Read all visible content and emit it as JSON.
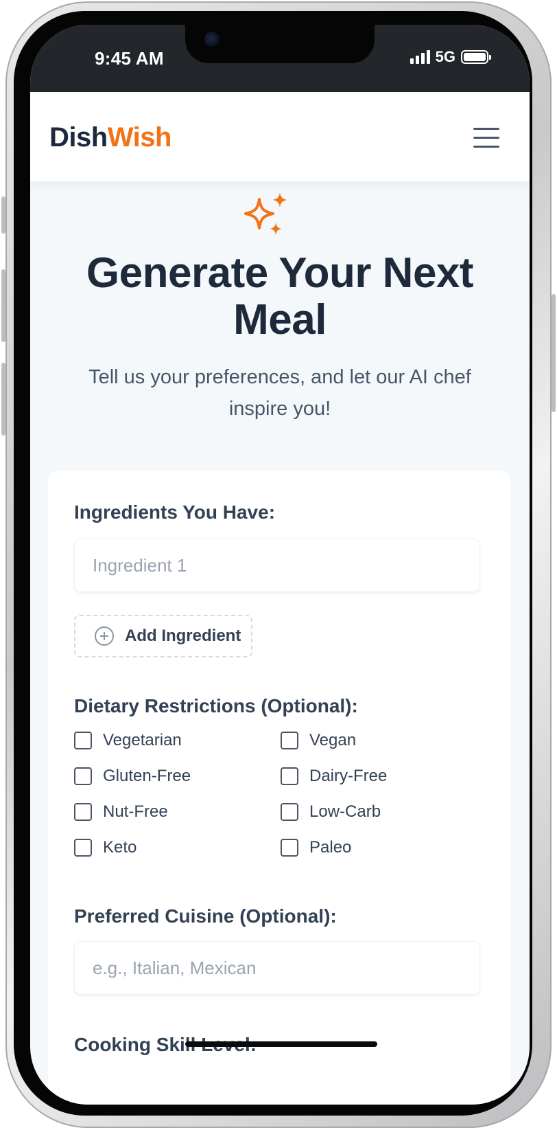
{
  "status_bar": {
    "time": "9:45 AM",
    "network": "5G",
    "battery_level": 1.0
  },
  "header": {
    "brand_part1": "Dish",
    "brand_part2": "Wish",
    "menu_icon": "hamburger-menu-icon",
    "accent_color": "#f47216",
    "brand_dark_color": "#1e293b"
  },
  "hero": {
    "icon": "sparkles-icon",
    "title": "Generate Your Next Meal",
    "subtitle": "Tell us your preferences, and let our AI chef inspire you!"
  },
  "form": {
    "ingredients": {
      "label": "Ingredients You Have:",
      "input_placeholder": "Ingredient 1",
      "add_button_label": "Add Ingredient",
      "add_icon": "plus-circle-icon"
    },
    "dietary": {
      "label": "Dietary Restrictions (Optional):",
      "options": [
        {
          "label": "Vegetarian",
          "checked": false
        },
        {
          "label": "Vegan",
          "checked": false
        },
        {
          "label": "Gluten-Free",
          "checked": false
        },
        {
          "label": "Dairy-Free",
          "checked": false
        },
        {
          "label": "Nut-Free",
          "checked": false
        },
        {
          "label": "Low-Carb",
          "checked": false
        },
        {
          "label": "Keto",
          "checked": false
        },
        {
          "label": "Paleo",
          "checked": false
        }
      ]
    },
    "cuisine": {
      "label": "Preferred Cuisine (Optional):",
      "input_placeholder": "e.g., Italian, Mexican"
    },
    "skill": {
      "label": "Cooking Skill Level:"
    }
  }
}
